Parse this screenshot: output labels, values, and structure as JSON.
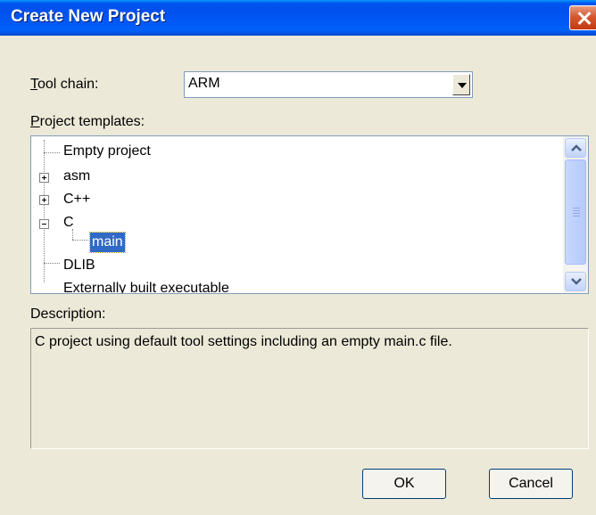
{
  "dialog": {
    "title": "Create New Project"
  },
  "toolchain": {
    "label_prefix": "T",
    "label_rest": "ool chain:",
    "value": "ARM"
  },
  "templates": {
    "label_prefix": "P",
    "label_rest": "roject templates:",
    "items": [
      "Empty project",
      "asm",
      "C++",
      "C",
      "main",
      "DLIB",
      "Externally built executable"
    ]
  },
  "description": {
    "label": "Description:",
    "text": "C project using default tool settings including an empty main.c file."
  },
  "buttons": {
    "ok": "OK",
    "cancel": "Cancel"
  }
}
